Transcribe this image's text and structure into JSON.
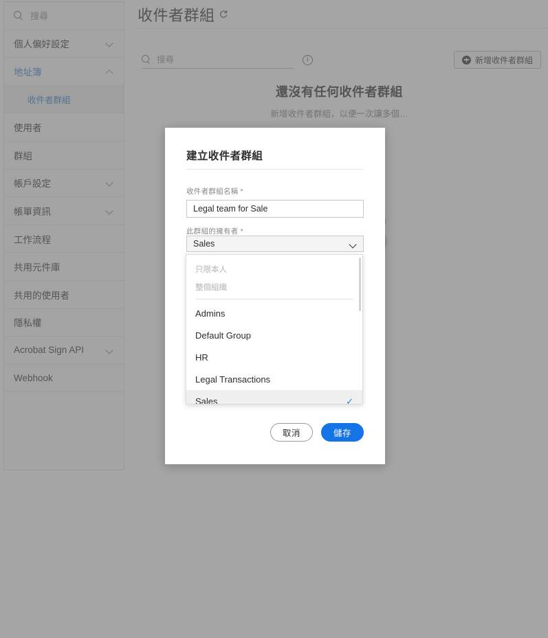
{
  "sidebar": {
    "search": {
      "placeholder": "搜尋",
      "icon": "search-icon"
    },
    "items": [
      {
        "label": "個人偏好設定",
        "chevron": "chevron-down-icon",
        "state": "collapsed"
      },
      {
        "label": "地址簿",
        "chevron": "chevron-up-icon",
        "state": "expanded"
      },
      {
        "label": "收件者群組",
        "chevron": "",
        "state": "sub-selected"
      },
      {
        "label": "使用者",
        "chevron": "",
        "state": "normal"
      },
      {
        "label": "群組",
        "chevron": "",
        "state": "normal"
      },
      {
        "label": "帳戶設定",
        "chevron": "chevron-down-icon",
        "state": "collapsed"
      },
      {
        "label": "帳單資訊",
        "chevron": "chevron-down-icon",
        "state": "collapsed"
      },
      {
        "label": "工作流程",
        "chevron": "",
        "state": "normal"
      },
      {
        "label": "共用元件庫",
        "chevron": "",
        "state": "normal"
      },
      {
        "label": "共用的使用者",
        "chevron": "",
        "state": "normal"
      },
      {
        "label": "隱私權",
        "chevron": "",
        "state": "normal"
      },
      {
        "label": "Acrobat Sign API",
        "chevron": "chevron-down-icon",
        "state": "collapsed"
      },
      {
        "label": "Webhook",
        "chevron": "",
        "state": "normal"
      }
    ]
  },
  "header": {
    "title": "收件者群組",
    "refresh_icon": "refresh-icon"
  },
  "toolbar": {
    "search_placeholder": "搜尋",
    "search_value": "",
    "search_icon": "search-icon",
    "info_icon": "info-icon",
    "info_glyph": "i",
    "add_button_label": "新增收件者群組",
    "add_button_icon": "plus-circle-icon"
  },
  "empty_state": {
    "title": "還沒有任何收件者群組",
    "subtitle": "新增收件者群組，以便一次讓多個…"
  },
  "modal": {
    "title": "建立收件者群組",
    "name_field": {
      "label": "收件者群組名稱",
      "required_mark": "*",
      "value": "Legal team for Sale",
      "placeholder": ""
    },
    "owner_field": {
      "label": "此群組的擁有者",
      "required_mark": "*",
      "selected": "Sales",
      "chevron": "chevron-down-icon"
    },
    "dropdown": {
      "options": [
        {
          "label": "只限本人",
          "disabled": true,
          "selected": false
        },
        {
          "label": "整個組織",
          "disabled": true,
          "selected": false
        },
        {
          "label": "Admins",
          "disabled": false,
          "selected": false
        },
        {
          "label": "Default Group",
          "disabled": false,
          "selected": false
        },
        {
          "label": "HR",
          "disabled": false,
          "selected": false
        },
        {
          "label": "Legal Transactions",
          "disabled": false,
          "selected": false
        },
        {
          "label": "Sales",
          "disabled": false,
          "selected": true
        }
      ],
      "check_glyph": "✓"
    },
    "cancel_label": "取消",
    "save_label": "儲存"
  },
  "colors": {
    "accent_blue": "#1473e6",
    "link_blue": "#2c7cd1",
    "check_blue": "#2680eb",
    "overlay": "#6e6e6e",
    "illustration_teal": "#0d6d6d",
    "illustration_gray": "#9aa3b0"
  }
}
